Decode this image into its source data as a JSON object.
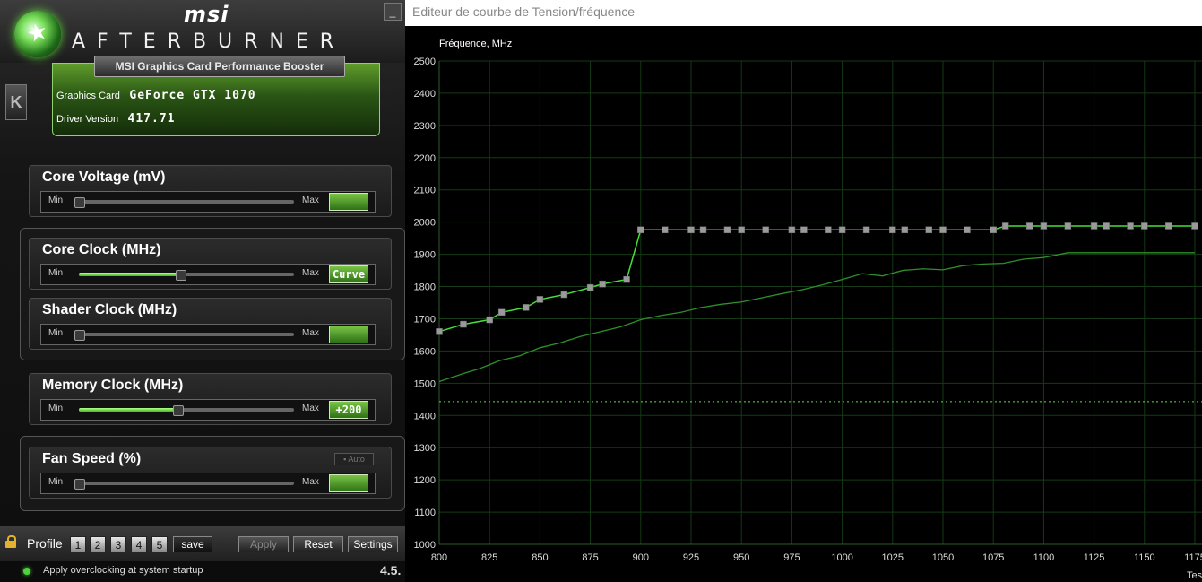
{
  "afterburner": {
    "brand": "msi",
    "product": "AFTERBURNER",
    "banner": "MSI Graphics Card Performance Booster",
    "graphics_card_label": "Graphics Card",
    "graphics_card_value": "GeForce GTX 1070",
    "driver_label": "Driver Version",
    "driver_value": "417.71",
    "side_tab": "K",
    "minimize": "_",
    "sliders": [
      {
        "title": "Core Voltage (mV)",
        "min": "Min",
        "max": "Max",
        "value": "",
        "level": 0.0
      },
      {
        "title": "Core Clock (MHz)",
        "min": "Min",
        "max": "Max",
        "value": "Curve",
        "level": 0.47
      },
      {
        "title": "Shader Clock (MHz)",
        "min": "Min",
        "max": "Max",
        "value": "",
        "level": 0.0
      },
      {
        "title": "Memory Clock (MHz)",
        "min": "Min",
        "max": "Max",
        "value": "+200",
        "level": 0.46
      },
      {
        "title": "Fan Speed (%)",
        "min": "Min",
        "max": "Max",
        "value": "",
        "level": 0.0,
        "auto_label": "Auto"
      }
    ],
    "profile_label": "Profile",
    "profiles": [
      "1",
      "2",
      "3",
      "4",
      "5"
    ],
    "save_label": "save",
    "apply_label": "Apply",
    "reset_label": "Reset",
    "settings_label": "Settings",
    "startup_text": "Apply overclocking at system startup",
    "version": "4.5."
  },
  "editor": {
    "title": "Editeur de courbe de Tension/fréquence",
    "x_label_partial": "Tes"
  },
  "chart_data": {
    "type": "line",
    "ylabel": "Fréquence, MHz",
    "xlim": [
      800,
      1175
    ],
    "ylim": [
      1000,
      2500
    ],
    "x_ticks": [
      800,
      825,
      850,
      875,
      900,
      925,
      950,
      975,
      1000,
      1025,
      1050,
      1075,
      1100,
      1125,
      1150,
      1175
    ],
    "y_ticks": [
      1000,
      1100,
      1200,
      1300,
      1400,
      1500,
      1600,
      1700,
      1800,
      1900,
      2000,
      2100,
      2200,
      2300,
      2400,
      2500
    ],
    "grid": true,
    "reference_line": {
      "y": 1443,
      "style": "dotted"
    },
    "series": [
      {
        "role": "curve",
        "x": [
          800,
          812,
          825,
          831,
          843,
          850,
          862,
          875,
          881,
          893,
          900,
          912,
          925,
          931,
          943,
          950,
          962,
          975,
          981,
          993,
          1000,
          1012,
          1025,
          1031,
          1043,
          1050,
          1062,
          1075,
          1081,
          1093,
          1100,
          1112,
          1125,
          1131,
          1143,
          1150,
          1162,
          1175
        ],
        "y": [
          1660,
          1683,
          1697,
          1720,
          1735,
          1760,
          1775,
          1797,
          1808,
          1822,
          1976,
          1976,
          1976,
          1976,
          1976,
          1976,
          1976,
          1976,
          1976,
          1976,
          1976,
          1976,
          1976,
          1976,
          1976,
          1976,
          1976,
          1976,
          1988,
          1988,
          1988,
          1988,
          1988,
          1988,
          1988,
          1988,
          1988,
          1988
        ]
      },
      {
        "role": "baseline",
        "x": [
          800,
          812,
          820,
          830,
          840,
          850,
          860,
          870,
          880,
          890,
          900,
          910,
          920,
          930,
          940,
          950,
          960,
          970,
          980,
          990,
          1000,
          1010,
          1020,
          1030,
          1040,
          1050,
          1060,
          1070,
          1080,
          1090,
          1100,
          1112,
          1125,
          1150,
          1175
        ],
        "y": [
          1505,
          1530,
          1545,
          1570,
          1585,
          1610,
          1625,
          1645,
          1660,
          1675,
          1697,
          1710,
          1720,
          1735,
          1745,
          1752,
          1765,
          1778,
          1790,
          1805,
          1822,
          1840,
          1833,
          1850,
          1855,
          1852,
          1865,
          1870,
          1872,
          1885,
          1890,
          1905,
          1905,
          1905,
          1905
        ]
      }
    ]
  }
}
